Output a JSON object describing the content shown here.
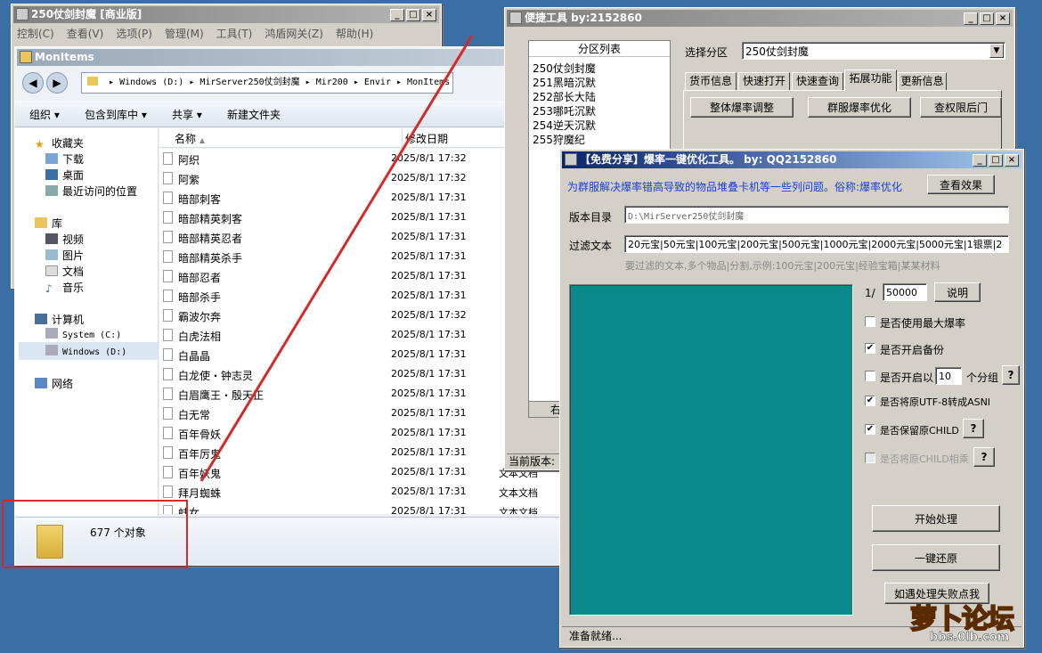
{
  "back_window": {
    "title": "250仗剑封魔 [商业版]",
    "menu": [
      "控制(C)",
      "查看(V)",
      "选项(P)",
      "管理(M)",
      "工具(T)",
      "鸿盾网关(Z)",
      "帮助(H)"
    ]
  },
  "explorer": {
    "title": "MonItems",
    "address": [
      "Windows (D:)",
      "MirServer250仗剑封魔",
      "Mir200",
      "Envir",
      "MonItems"
    ],
    "toolbar": [
      "组织",
      "包含到库中",
      "共享",
      "新建文件夹"
    ],
    "columns": {
      "name": "名称",
      "date": "修改日期"
    },
    "nav": {
      "favorites": "收藏夹",
      "fav_items": [
        "下载",
        "桌面",
        "最近访问的位置"
      ],
      "libraries": "库",
      "lib_items": [
        "视频",
        "图片",
        "文档",
        "音乐"
      ],
      "computer": "计算机",
      "drives": [
        "System (C:)",
        "Windows (D:)"
      ],
      "network": "网络"
    },
    "rows": [
      {
        "name": "阿织",
        "date": "2025/8/1 17:32",
        "type": ""
      },
      {
        "name": "阿紫",
        "date": "2025/8/1 17:32",
        "type": ""
      },
      {
        "name": "暗部刺客",
        "date": "2025/8/1 17:31",
        "type": ""
      },
      {
        "name": "暗部精英刺客",
        "date": "2025/8/1 17:31",
        "type": ""
      },
      {
        "name": "暗部精英忍者",
        "date": "2025/8/1 17:31",
        "type": ""
      },
      {
        "name": "暗部精英杀手",
        "date": "2025/8/1 17:31",
        "type": ""
      },
      {
        "name": "暗部忍者",
        "date": "2025/8/1 17:31",
        "type": ""
      },
      {
        "name": "暗部杀手",
        "date": "2025/8/1 17:31",
        "type": ""
      },
      {
        "name": "霸波尔奔",
        "date": "2025/8/1 17:32",
        "type": ""
      },
      {
        "name": "白虎法相",
        "date": "2025/8/1 17:31",
        "type": ""
      },
      {
        "name": "白晶晶",
        "date": "2025/8/1 17:31",
        "type": ""
      },
      {
        "name": "白龙使・钟志灵",
        "date": "2025/8/1 17:31",
        "type": ""
      },
      {
        "name": "白眉鹰王・殷天正",
        "date": "2025/8/1 17:31",
        "type": ""
      },
      {
        "name": "白无常",
        "date": "2025/8/1 17:31",
        "type": ""
      },
      {
        "name": "百年骨妖",
        "date": "2025/8/1 17:31",
        "type": ""
      },
      {
        "name": "百年厉鬼",
        "date": "2025/8/1 17:31",
        "type": ""
      },
      {
        "name": "百年妖鬼",
        "date": "2025/8/1 17:31",
        "type": "文本文档"
      },
      {
        "name": "拜月蜘蛛",
        "date": "2025/8/1 17:31",
        "type": "文本文档"
      },
      {
        "name": "蚌女",
        "date": "2025/8/1 17:31",
        "type": "文本文档"
      }
    ],
    "status_count": "677 个对象"
  },
  "quick_tool": {
    "title": "便捷工具    by:2152860",
    "list_header": "分区列表",
    "list": [
      "250仗剑封魔",
      "251黑暗沉默",
      "252部长大陆",
      "253哪吒沉默",
      "254逆天沉默",
      "255狩魔纪"
    ],
    "list_footer": "右",
    "select_label": "选择分区",
    "select_value": "250仗剑封魔",
    "tabs": [
      "货币信息",
      "快速打开",
      "快速查询",
      "拓展功能",
      "更新信息"
    ],
    "buttons": [
      "整体爆率调整",
      "群服爆率优化",
      "查权限后门"
    ],
    "status": "当前版本:"
  },
  "optimizer": {
    "title": "【免费分享】爆率一键优化工具。    by: QQ2152860",
    "headline": "为群服解决爆率错高导致的物品堆叠卡机等一些列问题。俗称:爆率优化",
    "view_effect": "查看效果",
    "dir_label": "版本目录",
    "dir_value": "D:\\MirServer250仗剑封魔",
    "filter_label": "过滤文本",
    "filter_value": "20元宝|50元宝|100元宝|200元宝|500元宝|1000元宝|2000元宝|5000元宝|1银票|2",
    "filter_hint": "要过滤的文本,多个物品|分割,示例:100元宝|200元宝|经验宝箱|某某材料",
    "ratio_prefix": "1/",
    "ratio_value": "50000",
    "explain": "说明",
    "opt_max": "是否使用最大爆率",
    "opt_backup": "是否开启备份",
    "opt_group_prefix": "是否开启以",
    "opt_group_value": "10",
    "opt_group_suffix": "个分组",
    "opt_utf8": "是否将原UTF-8转成ASNI",
    "opt_child": "是否保留原CHILD",
    "opt_child_mul": "是否将原CHILD相乘",
    "help": "?",
    "start": "开始处理",
    "restore": "一键还原",
    "fail_help": "如遇处理失败点我",
    "status": "准备就绪..."
  },
  "watermark": {
    "brand": "萝卜论坛",
    "url": "bbs.0lb.com"
  }
}
